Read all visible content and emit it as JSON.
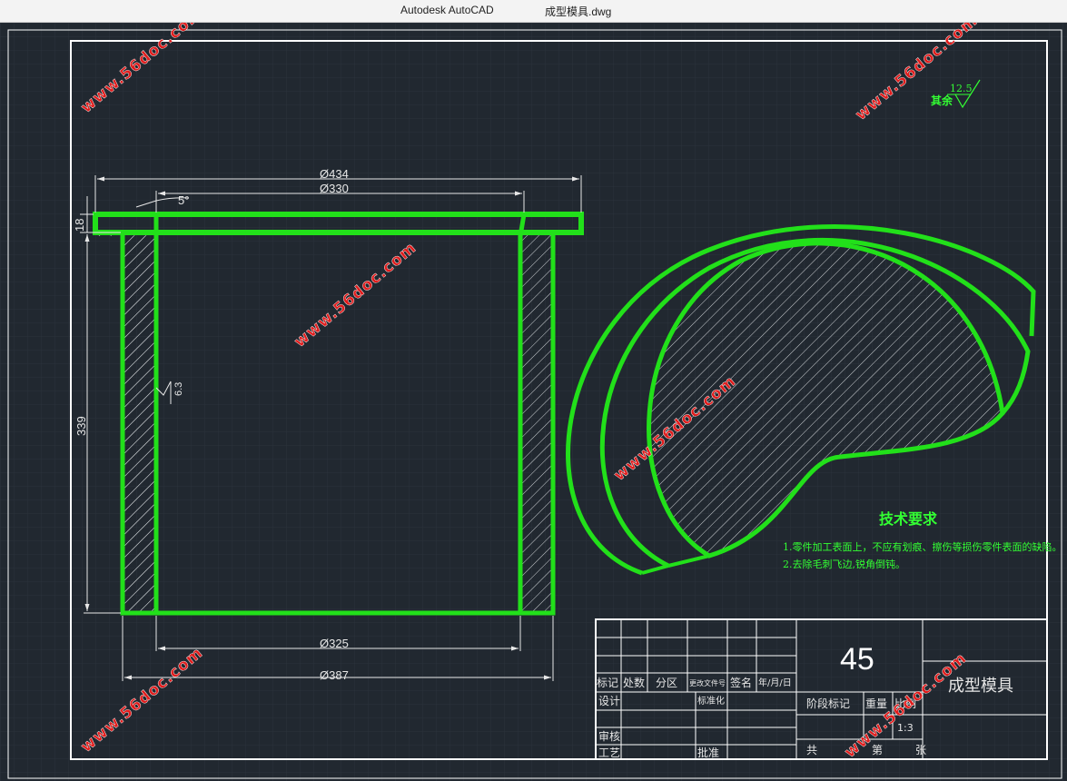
{
  "window": {
    "app_name": "Autodesk AutoCAD",
    "file_name": "成型模具.dwg"
  },
  "colors": {
    "background": "#212830",
    "part_outline": "#22e01a",
    "dimension": "#e8e8e8",
    "watermark": "#e11d1d",
    "requirements_text": "#33ff33"
  },
  "dimensions": {
    "outer_flange_dia": "Ø434",
    "inner_top_dia": "Ø330",
    "bottom_inner_dia": "Ø325",
    "bottom_outer_dia": "Ø387",
    "flange_thickness": "18",
    "height": "339",
    "draft_angle": "5°",
    "surface_roughness_side": "6.3"
  },
  "roughness_note": {
    "label": "其余",
    "value": "12.5"
  },
  "tech_requirements": {
    "title": "技术要求",
    "items": [
      "1.零件加工表面上，不应有划痕、擦伤等损伤零件表面的缺陷。",
      "2.去除毛刺飞边,锐角倒钝。"
    ]
  },
  "title_block": {
    "material": "45",
    "part_name": "成型模具",
    "scale": "1:3",
    "labels": {
      "mark": "标记",
      "count": "处数",
      "zone": "分区",
      "change_doc": "更改文件号",
      "signature": "签名",
      "date": "年/月/日",
      "design": "设计",
      "standardization": "标准化",
      "stage_mark": "阶段标记",
      "weight": "重量",
      "ratio": "比例",
      "review": "审核",
      "process": "工艺",
      "approve": "批准",
      "total": "共",
      "sheet_no": "第",
      "sheets": "张"
    }
  },
  "watermark_text": "www.56doc.com"
}
